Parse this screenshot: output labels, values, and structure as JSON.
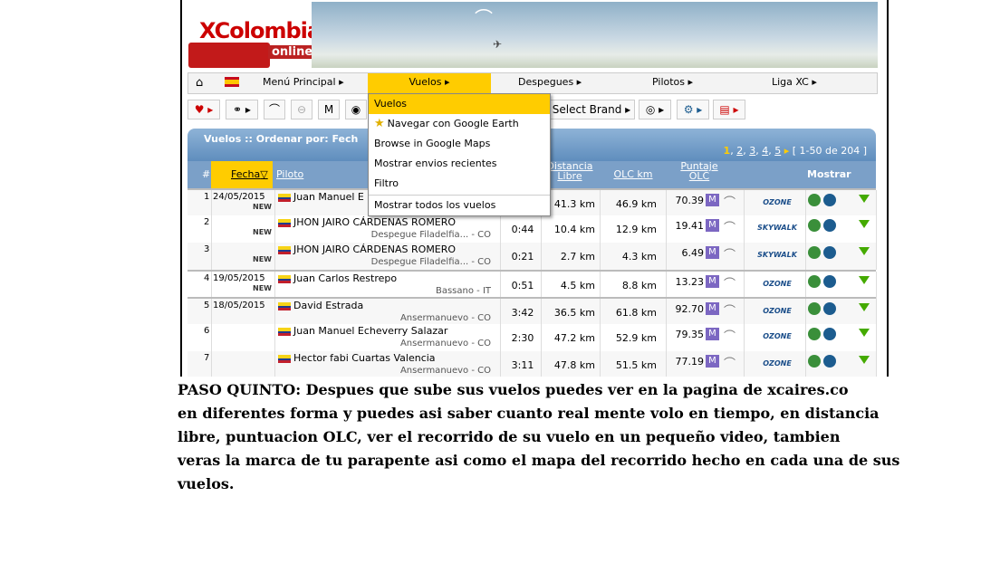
{
  "logo": {
    "brand": "XColombia",
    "subtitle": "online"
  },
  "menu": {
    "items": [
      {
        "label": "Menú Principal",
        "selected": false
      },
      {
        "label": "Vuelos",
        "selected": true
      },
      {
        "label": "Despegues",
        "selected": false
      },
      {
        "label": "Pilotos",
        "selected": false
      },
      {
        "label": "Liga XC",
        "selected": false
      }
    ],
    "home_icon": "home-icon",
    "flag_icon": "spain-flag-icon"
  },
  "dropdown": {
    "items": [
      {
        "label": "Vuelos",
        "icon": ""
      },
      {
        "label": "Navegar con Google Earth",
        "icon": "star-icon"
      },
      {
        "label": "Browse in Google Maps",
        "icon": ""
      },
      {
        "label": "Mostrar envios recientes",
        "icon": ""
      },
      {
        "label": "Filtro",
        "icon": ""
      },
      {
        "label": "Mostrar todos los vuelos",
        "icon": ""
      }
    ]
  },
  "toolbar": {
    "brand_label": "Select Brand"
  },
  "panel": {
    "title": "Vuelos :: Ordenar por: Fech",
    "pager": {
      "current": "1",
      "pages": [
        "2",
        "3",
        "4",
        "5"
      ],
      "range": "[ 1-50 de 204 ]"
    }
  },
  "table": {
    "headers": {
      "num": "#",
      "date": "Fecha",
      "pilot": "Piloto",
      "dist1": "Distancia",
      "dist2": "Libre",
      "olc": "OLC km",
      "pts1": "Puntaje",
      "pts2": "OLC",
      "show": "Mostrar"
    },
    "rows": [
      {
        "num": "1",
        "date": "24/05/2015",
        "new": "NEW",
        "pilot": "Juan Manuel E",
        "site": "",
        "dur": "",
        "dist": "41.3 km",
        "olc": "46.9 km",
        "pts": "70.39",
        "brand": "OZONE"
      },
      {
        "num": "2",
        "date": "",
        "new": "NEW",
        "pilot": "JHON JAIRO CÁRDENAS ROMERO",
        "site": "Despegue Filadelfia... - CO",
        "dur": "0:44",
        "dist": "10.4 km",
        "olc": "12.9 km",
        "pts": "19.41",
        "brand": "SKYWALK"
      },
      {
        "num": "3",
        "date": "",
        "new": "NEW",
        "pilot": "JHON JAIRO CÁRDENAS ROMERO",
        "site": "Despegue Filadelfia... - CO",
        "dur": "0:21",
        "dist": "2.7 km",
        "olc": "4.3 km",
        "pts": "6.49",
        "brand": "SKYWALK"
      },
      {
        "num": "4",
        "date": "19/05/2015",
        "new": "NEW",
        "pilot": "Juan Carlos Restrepo",
        "site": "Bassano - IT",
        "dur": "0:51",
        "dist": "4.5 km",
        "olc": "8.8 km",
        "pts": "13.23",
        "brand": "OZONE"
      },
      {
        "num": "5",
        "date": "18/05/2015",
        "new": "",
        "pilot": "David Estrada",
        "site": "Ansermanuevo - CO",
        "dur": "3:42",
        "dist": "36.5 km",
        "olc": "61.8 km",
        "pts": "92.70",
        "brand": "OZONE"
      },
      {
        "num": "6",
        "date": "",
        "new": "",
        "pilot": "Juan Manuel Echeverry Salazar",
        "site": "Ansermanuevo - CO",
        "dur": "2:30",
        "dist": "47.2 km",
        "olc": "52.9 km",
        "pts": "79.35",
        "brand": "OZONE"
      },
      {
        "num": "7",
        "date": "",
        "new": "",
        "pilot": "Hector fabi Cuartas Valencia",
        "site": "Ansermanuevo - CO",
        "dur": "3:11",
        "dist": "47.8 km",
        "olc": "51.5 km",
        "pts": "77.19",
        "brand": "OZONE"
      }
    ]
  },
  "caption": {
    "lines": [
      "PASO QUINTO: Despues que sube sus vuelos puedes ver en la pagina de xcaires.co",
      "en diferentes forma y puedes asi saber cuanto real mente volo en tiempo, en distancia",
      "libre, puntuacion OLC, ver el recorrido de su vuelo en un pequeño video, tambien",
      "veras la marca de tu parapente asi como el mapa del recorrido hecho en cada una de sus",
      "vuelos."
    ]
  }
}
